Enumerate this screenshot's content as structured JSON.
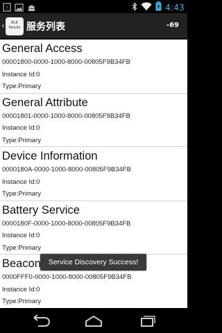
{
  "status_bar": {
    "time": "4:43",
    "left_icons": [
      "notification-icon",
      "image-icon",
      "android-icon"
    ],
    "right_icons": [
      "bluetooth-icon",
      "wifi-icon",
      "battery-icon"
    ]
  },
  "action_bar": {
    "logo_text_line1": "BLE",
    "logo_text_line2": "Reado",
    "title": "服务列表",
    "rssi": "-69"
  },
  "services": [
    {
      "name": "General Access",
      "uuid": "00001800-0000-1000-8000-00805F9B34FB",
      "instance": "Instance Id:0",
      "type": "Type:Primary"
    },
    {
      "name": "General Attribute",
      "uuid": "00001801-0000-1000-8000-00805F9B34FB",
      "instance": "Instance Id:0",
      "type": "Type:Primary"
    },
    {
      "name": "Device Information",
      "uuid": "0000180A-0000-1000-8000-00805F9B34FB",
      "instance": "Instance Id:0",
      "type": "Type:Primary"
    },
    {
      "name": "Battery Service",
      "uuid": "0000180F-0000-1000-8000-00805F9B34FB",
      "instance": "Instance Id:0",
      "type": "Type:Primary"
    },
    {
      "name": "Beacon",
      "uuid": "0000FFF0-0000-1000-8000-00805F9B34FB",
      "instance": "Instance Id:0",
      "type": "Type:Primary"
    }
  ],
  "toast": {
    "text": "Service Discovery Success!"
  },
  "nav_bar": {
    "buttons": [
      "back-icon",
      "home-icon",
      "recent-apps-icon"
    ]
  },
  "colors": {
    "time": "#33b5e5",
    "action_bar": "#222222",
    "content_bg": "#ffffff"
  }
}
